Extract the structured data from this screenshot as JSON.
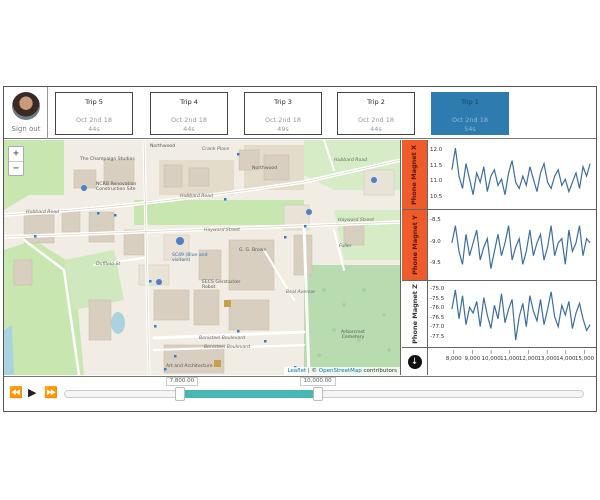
{
  "user": {
    "signout_label": "Sign out"
  },
  "trips": [
    {
      "name": "Trip 5",
      "date": "Oct 2nd 18",
      "duration": "44s",
      "active": false
    },
    {
      "name": "Trip 4",
      "date": "Oct 2nd 18",
      "duration": "44s",
      "active": false
    },
    {
      "name": "Trip 3",
      "date": "Oct 2nd 18",
      "duration": "49s",
      "active": false
    },
    {
      "name": "Trip 2",
      "date": "Oct 2nd 18",
      "duration": "44s",
      "active": false
    },
    {
      "name": "Trip 1",
      "date": "Oct 2nd 18",
      "duration": "54s",
      "active": true
    }
  ],
  "map": {
    "zoom_in": "+",
    "zoom_out": "−",
    "attribution_leaflet": "Leaflet",
    "attribution_sep": " | © ",
    "attribution_osm": "OpenStreetMap",
    "attribution_tail": " contributors",
    "labels": {
      "northwood_top": "Northwood",
      "crank_place": "Crank Place",
      "northwood_right": "Northwood",
      "hubbard_road_right": "Hubbard Road",
      "hubbard_road_mid": "Hubbard Road",
      "hubbard_road_left": "Hubbard Road",
      "champaign_studios": "The Champaign Studios",
      "ncrb": "NCRB Renovation Construction Site",
      "hayward_street": "Hayward Street",
      "hayward_street_right": "Hayward Street",
      "duffield_st": "Duffield St",
      "lot_sc49": "SC49 (Blue and visitors)",
      "gg_brown": "G. G. Brown",
      "eeb": "EECS Gerstacker Robot",
      "bonisteel_1": "Bonisteel Boulevard",
      "bonisteel_2": "Bonisteel Boulevard",
      "art_architecture": "Art and Architecture",
      "arborcrest": "Arborcrest Cemetery",
      "beal_ave": "Beal Avenue",
      "fuller": "Fuller"
    }
  },
  "sensors": {
    "rows": [
      {
        "label": "Phone Magnet X",
        "active": true,
        "yticks": [
          "12.0",
          "11.5",
          "11.0",
          "10.5"
        ],
        "ymin": 10.3,
        "ymax": 12.2,
        "values": [
          11.4,
          12.1,
          11.2,
          10.8,
          11.6,
          11.1,
          10.6,
          11.3,
          11.0,
          11.5,
          10.7,
          11.2,
          11.4,
          10.9,
          11.1,
          10.6,
          11.3,
          11.7,
          11.0,
          10.8,
          11.2,
          10.9,
          11.5,
          11.1,
          10.7,
          11.3,
          11.6,
          11.0,
          10.8,
          11.2,
          11.4,
          10.9,
          11.1,
          10.7,
          11.0,
          11.3,
          10.8,
          11.5,
          11.2,
          11.6
        ]
      },
      {
        "label": "Phone Magnet Y",
        "active": true,
        "yticks": [
          "-8.5",
          "-9.0",
          "-9.5"
        ],
        "ymin": -9.75,
        "ymax": -8.35,
        "values": [
          -9.0,
          -8.6,
          -9.2,
          -9.5,
          -8.8,
          -9.3,
          -9.0,
          -8.7,
          -9.4,
          -9.1,
          -8.9,
          -9.6,
          -9.2,
          -8.8,
          -9.3,
          -9.0,
          -8.6,
          -9.4,
          -9.1,
          -8.9,
          -9.5,
          -9.2,
          -8.7,
          -9.3,
          -9.0,
          -8.8,
          -9.4,
          -9.1,
          -8.6,
          -9.3,
          -9.0,
          -8.9,
          -9.5,
          -8.7,
          -9.2,
          -9.0,
          -8.6,
          -9.3,
          -8.9,
          -9.0
        ]
      },
      {
        "label": "Phone Magnet Z",
        "active": false,
        "yticks": [
          "-75.0",
          "-75.5",
          "-76.0",
          "-76.5",
          "-77.0",
          "-77.5"
        ],
        "ymin": -77.7,
        "ymax": -74.8,
        "values": [
          -76.0,
          -75.0,
          -76.5,
          -75.3,
          -76.8,
          -75.9,
          -76.2,
          -75.6,
          -76.9,
          -75.4,
          -76.3,
          -77.0,
          -75.8,
          -76.5,
          -75.2,
          -76.7,
          -76.0,
          -75.5,
          -77.6,
          -76.4,
          -75.7,
          -76.9,
          -75.3,
          -76.1,
          -76.6,
          -75.5,
          -76.8,
          -76.0,
          -75.1,
          -76.4,
          -76.9,
          -75.8,
          -76.3,
          -75.6,
          -77.0,
          -76.2,
          -75.7,
          -76.5,
          -77.1,
          -76.8
        ]
      }
    ],
    "download_icon": "↓",
    "xticks": [
      "8,000",
      "9,000",
      "10,000",
      "11,000",
      "12,000",
      "13,000",
      "14,000",
      "15,000"
    ],
    "xmin": 7800,
    "xmax": 15400,
    "series_xmin": 7900,
    "series_xmax": 15300,
    "line_color": "#3b6ea2"
  },
  "playback": {
    "rewind_icon": "⏪",
    "play_icon": "▶",
    "forward_icon": "⏩",
    "range_start_label": "7,800.00",
    "range_end_label": "10,000.00",
    "range_start_fraction": 0.23,
    "range_end_fraction": 0.48,
    "range_color": "#46b7b2"
  }
}
